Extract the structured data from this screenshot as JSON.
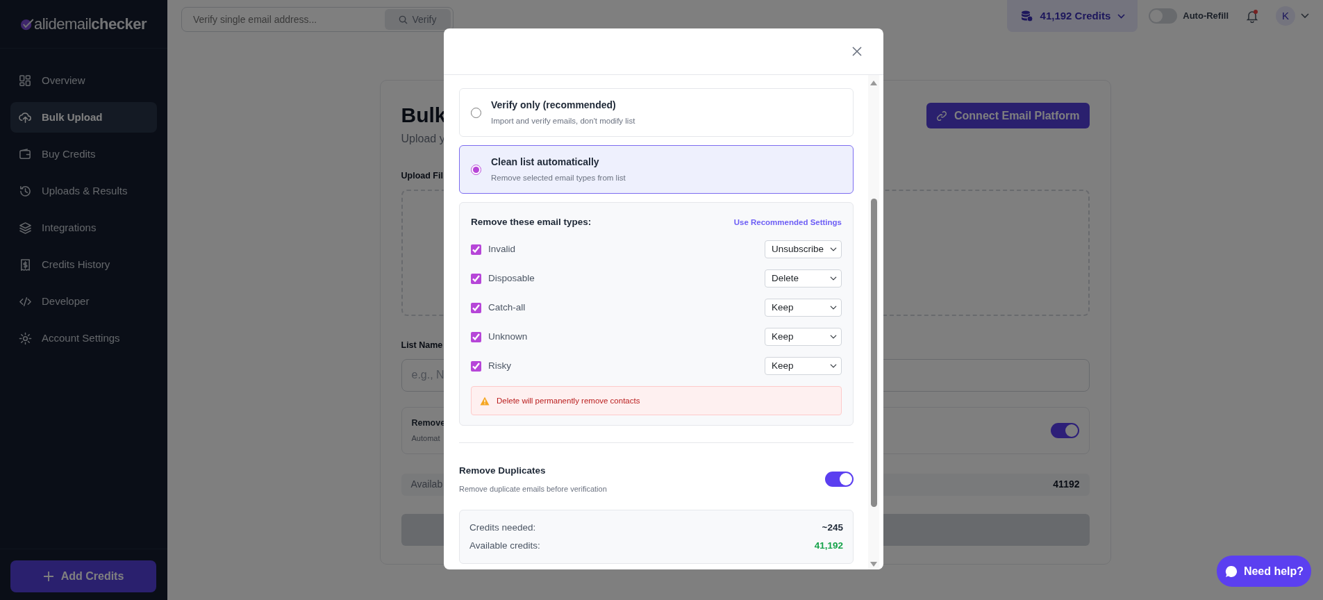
{
  "logo": {
    "light": "alidemail",
    "bold": "checker"
  },
  "sidebar": {
    "items": [
      {
        "label": "Overview",
        "selected": false
      },
      {
        "label": "Bulk Upload",
        "selected": true
      },
      {
        "label": "Buy Credits",
        "selected": false
      },
      {
        "label": "Uploads & Results",
        "selected": false
      },
      {
        "label": "Integrations",
        "selected": false
      },
      {
        "label": "Credits History",
        "selected": false
      },
      {
        "label": "Developer",
        "selected": false
      },
      {
        "label": "Account Settings",
        "selected": false
      }
    ],
    "add_button": "Add Credits"
  },
  "topbar": {
    "search": {
      "placeholder": "Verify single email address..."
    },
    "verify_button": "Verify",
    "credits": "41,192 Credits",
    "auto_refill": {
      "label": "Auto-Refill",
      "on": false
    },
    "notifications": {
      "unread": true
    },
    "avatar": "K"
  },
  "page": {
    "title": "Bulk",
    "subtitle": "Upload y",
    "connect_button": "Connect Email Platform",
    "upload_label": "Upload Fil",
    "list_name_label": "List Name",
    "list_name_placeholder": "e.g., N",
    "remove_setting": {
      "title": "Remove",
      "desc": "Automat",
      "on": true
    },
    "available_label": "Availab",
    "available_value": "41192"
  },
  "modal": {
    "options": [
      {
        "title": "Verify only (recommended)",
        "desc": "Import and verify emails, don't modify list",
        "selected": false
      },
      {
        "title": "Clean list automatically",
        "desc": "Remove selected email types from list",
        "selected": true
      }
    ],
    "email_types": {
      "title": "Remove these email types:",
      "link": "Use Recommended Settings",
      "rows": [
        {
          "label": "Invalid",
          "checked": true,
          "action": "Unsubscribe"
        },
        {
          "label": "Disposable",
          "checked": true,
          "action": "Delete"
        },
        {
          "label": "Catch-all",
          "checked": true,
          "action": "Keep"
        },
        {
          "label": "Unknown",
          "checked": true,
          "action": "Keep"
        },
        {
          "label": "Risky",
          "checked": true,
          "action": "Keep"
        }
      ],
      "warning": "Delete will permanently remove contacts"
    },
    "remove_duplicates": {
      "title": "Remove Duplicates",
      "desc": "Remove duplicate emails before verification",
      "on": true
    },
    "summary": [
      {
        "label": "Credits needed:",
        "value": "~245",
        "kind": "neutral"
      },
      {
        "label": "Available credits:",
        "value": "41,192",
        "kind": "positive"
      }
    ]
  },
  "help_button": "Need help?"
}
